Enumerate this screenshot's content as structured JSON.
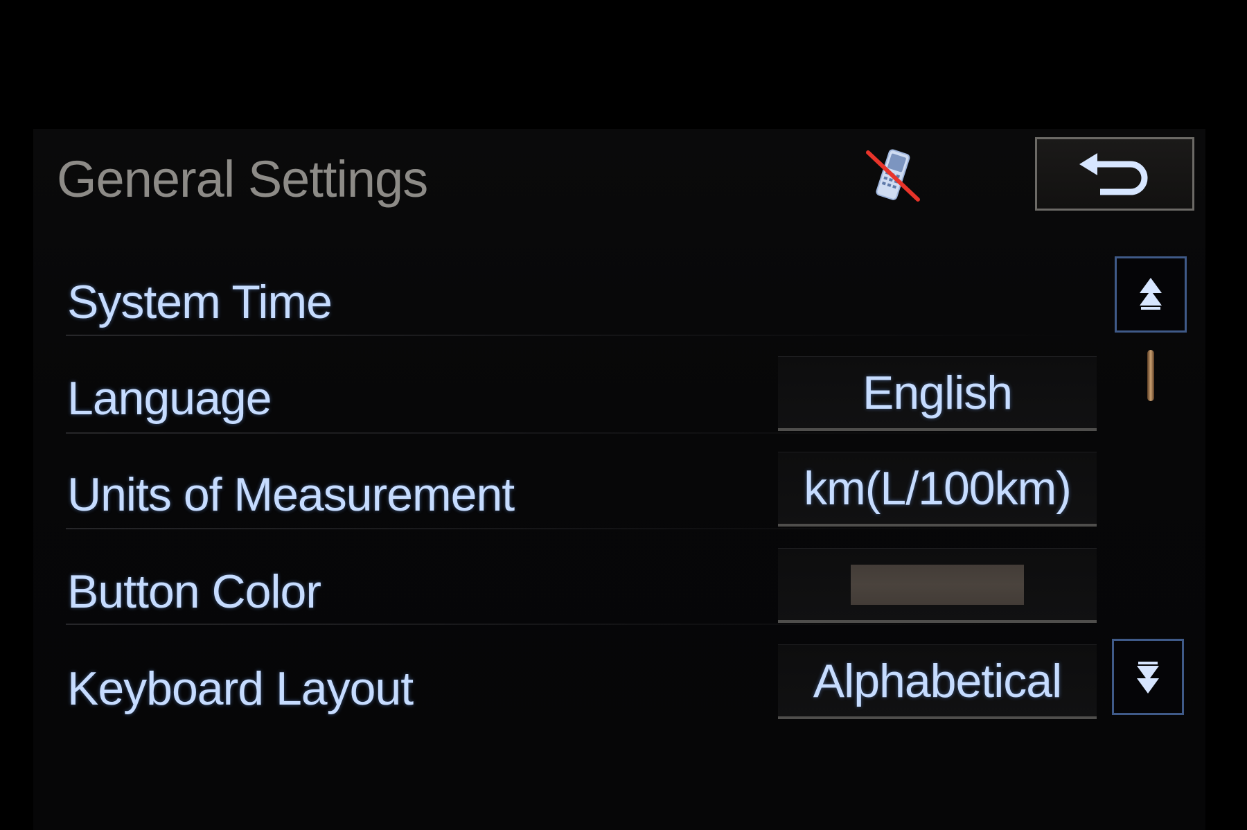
{
  "header": {
    "title": "General Settings",
    "phone_status_icon": "phone-disconnected-icon",
    "back_icon": "return-arrow-icon"
  },
  "settings": {
    "items": [
      {
        "label": "System Time",
        "value": null
      },
      {
        "label": "Language",
        "value": "English"
      },
      {
        "label": "Units of Measurement",
        "value": "km(L/100km)"
      },
      {
        "label": "Button Color",
        "value": null,
        "swatch_color": "#433c37"
      },
      {
        "label": "Keyboard Layout",
        "value": "Alphabetical"
      }
    ]
  },
  "scroll": {
    "up_icon": "scroll-up-icon",
    "down_icon": "scroll-down-icon",
    "position_fraction": 0.0
  },
  "colors": {
    "label_text": "#c6dcff",
    "title_text": "#8d8b87",
    "accent_border": "#3f5a88",
    "scroll_thumb": "#caa071",
    "no_phone_slash": "#e8342a"
  }
}
